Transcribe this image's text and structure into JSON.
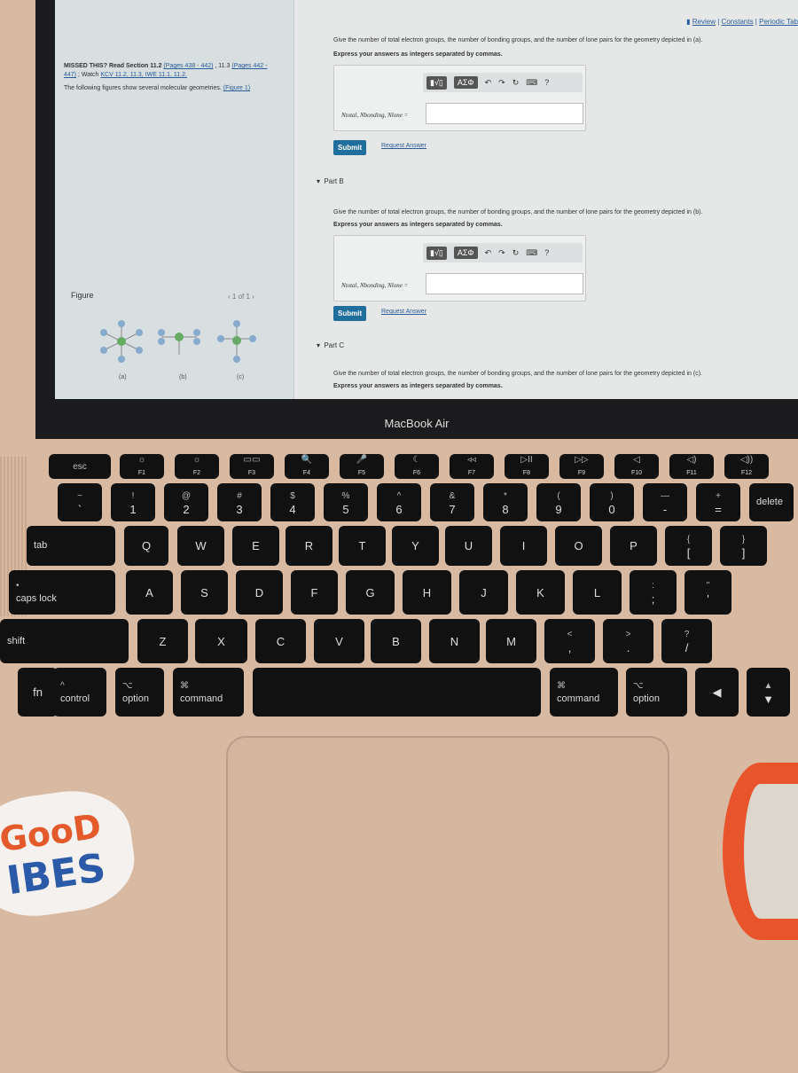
{
  "screen": {
    "left": {
      "missed_prefix": "MISSED THIS? Read Section 11.2 ",
      "missed_link1": "(Pages 438 - 442)",
      "missed_mid": " , 11.3 ",
      "missed_link2": "(Pages 442 - 447)",
      "missed_watch": " ; Watch ",
      "missed_link3": "KCV 11.2, 11.3, IWE 11.1, 11.2.",
      "intro": "The following figures show several molecular geometries.",
      "intro_link": "(Figure 1)",
      "figure_title": "Figure",
      "pager": "1 of 1",
      "labels": [
        "(a)",
        "(b)",
        "(c)"
      ]
    },
    "links": [
      "Review",
      "Constants",
      "Periodic Tab"
    ],
    "partA": {
      "question": "Give the number of total electron groups, the number of bonding groups, and the number of lone pairs for the geometry depicted in (a).",
      "instruction": "Express your answers as integers separated by commas.",
      "label": "Ntotal, Nbonding, Nlone =",
      "value": ""
    },
    "partB": {
      "title": "Part B",
      "question": "Give the number of total electron groups, the number of bonding groups, and the number of lone pairs for the geometry depicted in (b).",
      "instruction": "Express your answers as integers separated by commas.",
      "label": "Ntotal, Nbonding, Nlone =",
      "value": ""
    },
    "partC": {
      "title": "Part C",
      "question": "Give the number of total electron groups, the number of bonding groups, and the number of lone pairs for the geometry depicted in (c).",
      "instruction": "Express your answers as integers separated by commas."
    },
    "toolbar": {
      "templates": "▮√▯",
      "greek": "ΑΣΦ",
      "undo": "↶",
      "redo": "↷",
      "reset": "↻",
      "keyboard": "⌨",
      "help": "?"
    },
    "submit": "Submit",
    "request": "Request Answer"
  },
  "brand": "MacBook Air",
  "keyboard": {
    "function_row": [
      [
        "esc",
        ""
      ],
      [
        "☼",
        "F1"
      ],
      [
        "☼",
        "F2"
      ],
      [
        "▭▭",
        "F3"
      ],
      [
        "🔍",
        "F4"
      ],
      [
        "🎤",
        "F5"
      ],
      [
        "☾",
        "F6"
      ],
      [
        "◃◃",
        "F7"
      ],
      [
        "▷II",
        "F8"
      ],
      [
        "▷▷",
        "F9"
      ],
      [
        "◁",
        "F10"
      ],
      [
        "◁)",
        "F11"
      ],
      [
        "◁))",
        "F12"
      ]
    ],
    "number_row": [
      [
        "~",
        "`"
      ],
      [
        "!",
        "1"
      ],
      [
        "@",
        "2"
      ],
      [
        "#",
        "3"
      ],
      [
        "$",
        "4"
      ],
      [
        "%",
        "5"
      ],
      [
        "^",
        "6"
      ],
      [
        "&",
        "7"
      ],
      [
        "*",
        "8"
      ],
      [
        "(",
        "9"
      ],
      [
        ")",
        "0"
      ],
      [
        "—",
        "-"
      ],
      [
        "+",
        "="
      ],
      [
        "",
        "delete"
      ]
    ],
    "top_row": [
      [
        "",
        "tab"
      ],
      [
        "",
        "Q"
      ],
      [
        "",
        "W"
      ],
      [
        "",
        "E"
      ],
      [
        "",
        "R"
      ],
      [
        "",
        "T"
      ],
      [
        "",
        "Y"
      ],
      [
        "",
        "U"
      ],
      [
        "",
        "I"
      ],
      [
        "",
        "O"
      ],
      [
        "",
        "P"
      ],
      [
        "{",
        "["
      ],
      [
        "}",
        "]"
      ]
    ],
    "home_row": [
      [
        "•",
        "caps lock"
      ],
      [
        "",
        "A"
      ],
      [
        "",
        "S"
      ],
      [
        "",
        "D"
      ],
      [
        "",
        "F"
      ],
      [
        "",
        "G"
      ],
      [
        "",
        "H"
      ],
      [
        "",
        "J"
      ],
      [
        "",
        "K"
      ],
      [
        "",
        "L"
      ],
      [
        ":",
        ";"
      ],
      [
        "\"",
        "'"
      ]
    ],
    "bottom_row": [
      [
        "",
        "shift"
      ],
      [
        "",
        "Z"
      ],
      [
        "",
        "X"
      ],
      [
        "",
        "C"
      ],
      [
        "",
        "V"
      ],
      [
        "",
        "B"
      ],
      [
        "",
        "N"
      ],
      [
        "",
        "M"
      ],
      [
        "<",
        ","
      ],
      [
        ">",
        "."
      ],
      [
        "?",
        "/"
      ]
    ],
    "mod_row": [
      [
        "",
        "fn"
      ],
      [
        "^",
        "control"
      ],
      [
        "⌥",
        "option"
      ],
      [
        "⌘",
        "command"
      ],
      [
        "",
        ""
      ],
      [
        "⌘",
        "command"
      ],
      [
        "⌥",
        "option"
      ],
      [
        "",
        "◀"
      ],
      [
        "▲",
        "▼"
      ]
    ]
  },
  "sticker": {
    "line1": "GooD",
    "line2": "IBES"
  }
}
